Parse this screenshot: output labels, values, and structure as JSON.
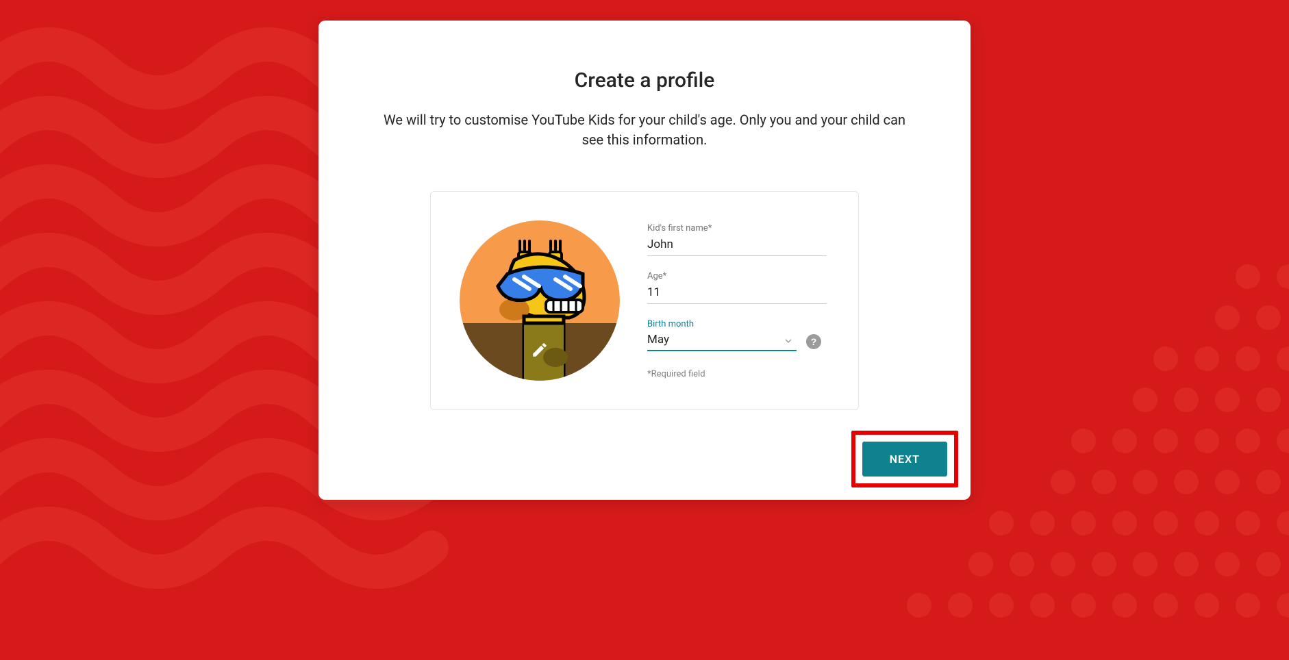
{
  "colors": {
    "bg": "#d61a1a",
    "accent": "#0f828f",
    "highlight_border": "#e60000"
  },
  "title": "Create a profile",
  "subtitle": "We will try to customise YouTube Kids for your child's age. Only you and your child can see this information.",
  "form": {
    "name_label": "Kid's first name*",
    "name_value": "John",
    "age_label": "Age*",
    "age_value": "11",
    "month_label": "Birth month",
    "month_value": "May",
    "required_note": "*Required field"
  },
  "avatar": {
    "description": "giraffe-with-sunglasses",
    "edit_icon": "pencil-icon"
  },
  "help_icon_text": "?",
  "next_label": "NEXT"
}
